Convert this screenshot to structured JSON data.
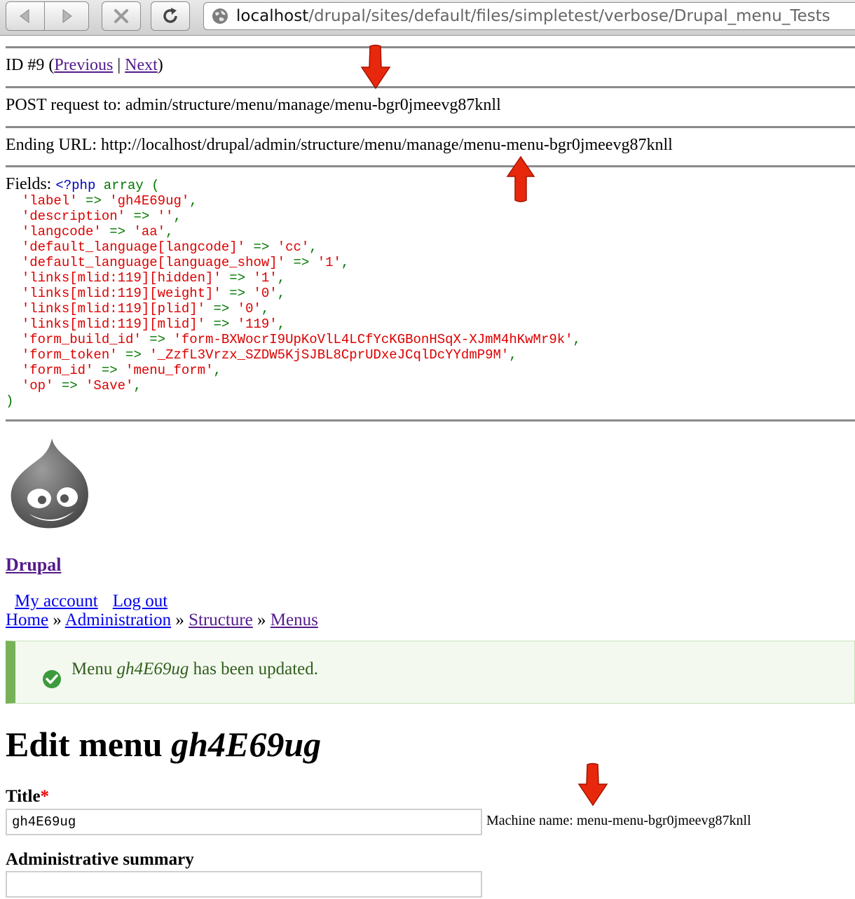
{
  "browser": {
    "url_host": "localhost",
    "url_path": "/drupal/sites/default/files/simpletest/verbose/Drupal_menu_Tests"
  },
  "verbose": {
    "id_text": "ID #9 (",
    "prev_label": "Previous",
    "sep": " | ",
    "next_label": "Next",
    "close": ")",
    "post_line": "POST request to: admin/structure/menu/manage/menu-bgr0jmeevg87knll",
    "ending_line": "Ending URL: http://localhost/drupal/admin/structure/menu/manage/menu-menu-bgr0jmeevg87knll",
    "fields_label": "Fields: ",
    "php_open": "<?php",
    "array_kw": "array (",
    "fields": [
      {
        "key": "'label'",
        "value": "'gh4E69ug'"
      },
      {
        "key": "'description'",
        "value": "''"
      },
      {
        "key": "'langcode'",
        "value": "'aa'"
      },
      {
        "key": "'default_language[langcode]'",
        "value": "'cc'"
      },
      {
        "key": "'default_language[language_show]'",
        "value": "'1'"
      },
      {
        "key": "'links[mlid:119][hidden]'",
        "value": "'1'"
      },
      {
        "key": "'links[mlid:119][weight]'",
        "value": "'0'"
      },
      {
        "key": "'links[mlid:119][plid]'",
        "value": "'0'"
      },
      {
        "key": "'links[mlid:119][mlid]'",
        "value": "'119'"
      },
      {
        "key": "'form_build_id'",
        "value": "'form-BXWocrI9UpKoVlL4LCfYcKGBonHSqX-XJmM4hKwMr9k'"
      },
      {
        "key": "'form_token'",
        "value": "'_ZzfL3Vrzx_SZDW5KjSJBL8CprUDxeJCqlDcYYdmP9M'"
      },
      {
        "key": "'form_id'",
        "value": "'menu_form'"
      },
      {
        "key": "'op'",
        "value": "'Save'"
      }
    ],
    "array_close": ")"
  },
  "site": {
    "name": "Drupal",
    "user_menu": [
      "My account",
      "Log out"
    ],
    "breadcrumb": [
      "Home",
      "Administration",
      "Structure",
      "Menus"
    ],
    "breadcrumb_sep": " » "
  },
  "status_message": {
    "before": "Menu ",
    "menu_name": "gh4E69ug",
    "after": " has been updated."
  },
  "page": {
    "title_prefix": "Edit menu ",
    "title_name": "gh4E69ug",
    "title_label": "Title",
    "required_mark": "*",
    "title_value": "gh4E69ug",
    "machine_name": "Machine name: menu-menu-bgr0jmeevg87knll",
    "summary_label": "Administrative summary",
    "summary_value": ""
  },
  "colors": {
    "annotation_arrow": "#e8280c",
    "php_keyword": "#0000bb",
    "php_operator": "#007700",
    "php_string": "#dd0000",
    "status_green": "#77b259"
  }
}
